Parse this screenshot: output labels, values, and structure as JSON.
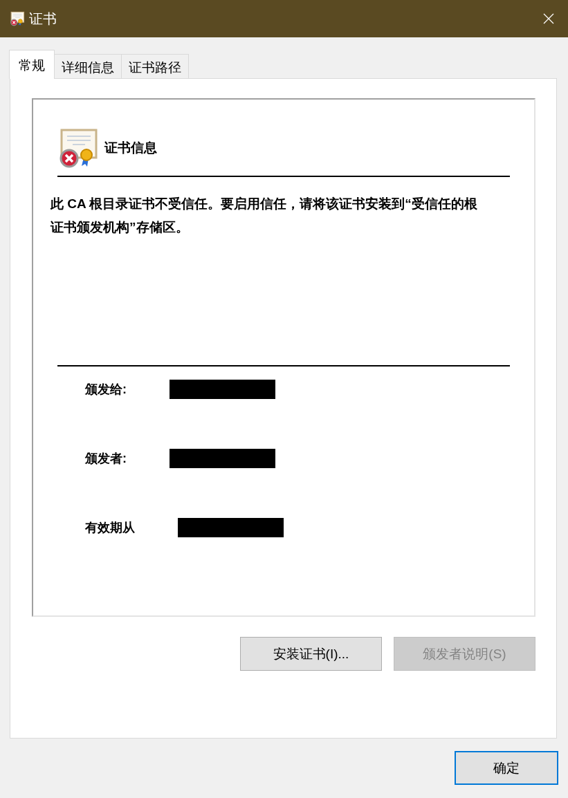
{
  "window": {
    "title": "证书"
  },
  "tabs": [
    {
      "label": "常规",
      "selected": true
    },
    {
      "label": "详细信息",
      "selected": false
    },
    {
      "label": "证书路径",
      "selected": false
    }
  ],
  "info": {
    "title": "证书信息",
    "message": "此 CA 根目录证书不受信任。要启用信任，请将该证书安装到“受信任的根证书颁发机构”存储区。",
    "fields": [
      {
        "label": "颁发给:",
        "redacted": true
      },
      {
        "label": "颁发者:",
        "redacted": true
      },
      {
        "label": "有效期从",
        "redacted": true
      }
    ]
  },
  "buttons": [
    {
      "label": "安装证书(I)...",
      "disabled": false
    },
    {
      "label": "颁发者说明(S)",
      "disabled": true
    }
  ],
  "ok_button": {
    "label": "确定"
  }
}
